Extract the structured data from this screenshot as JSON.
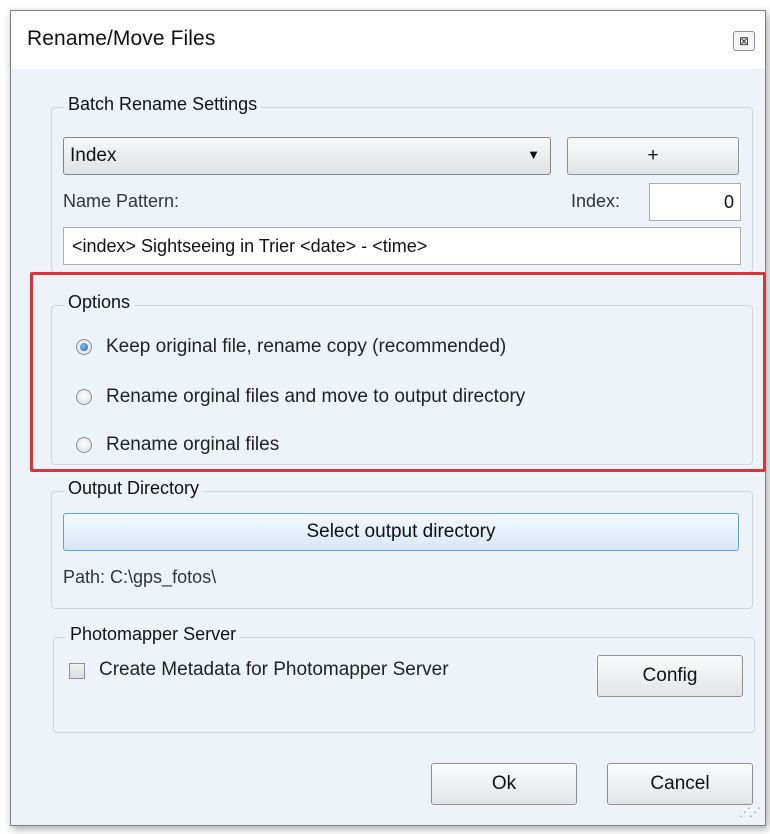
{
  "window": {
    "title": "Rename/Move Files",
    "close_label": "⊠"
  },
  "batch": {
    "legend": "Batch Rename Settings",
    "combo_value": "Index",
    "plus_label": "+",
    "pattern_label": "Name Pattern:",
    "index_label": "Index:",
    "index_value": "0",
    "pattern_value": "<index> Sightseeing in Trier <date> - <time>"
  },
  "options": {
    "legend": "Options",
    "items": [
      {
        "label": "Keep original file, rename copy (recommended)",
        "checked": true
      },
      {
        "label": "Rename orginal files and move to output directory",
        "checked": false
      },
      {
        "label": "Rename orginal files",
        "checked": false
      }
    ],
    "highlight_color": "#d9343b"
  },
  "output": {
    "legend": "Output Directory",
    "select_label": "Select output directory",
    "path_label": "Path: C:\\gps_fotos\\"
  },
  "photomapper": {
    "legend": "Photomapper Server",
    "checkbox_label": "Create Metadata for Photomapper Server",
    "checked": false,
    "config_label": "Config"
  },
  "footer": {
    "ok_label": "Ok",
    "cancel_label": "Cancel"
  }
}
